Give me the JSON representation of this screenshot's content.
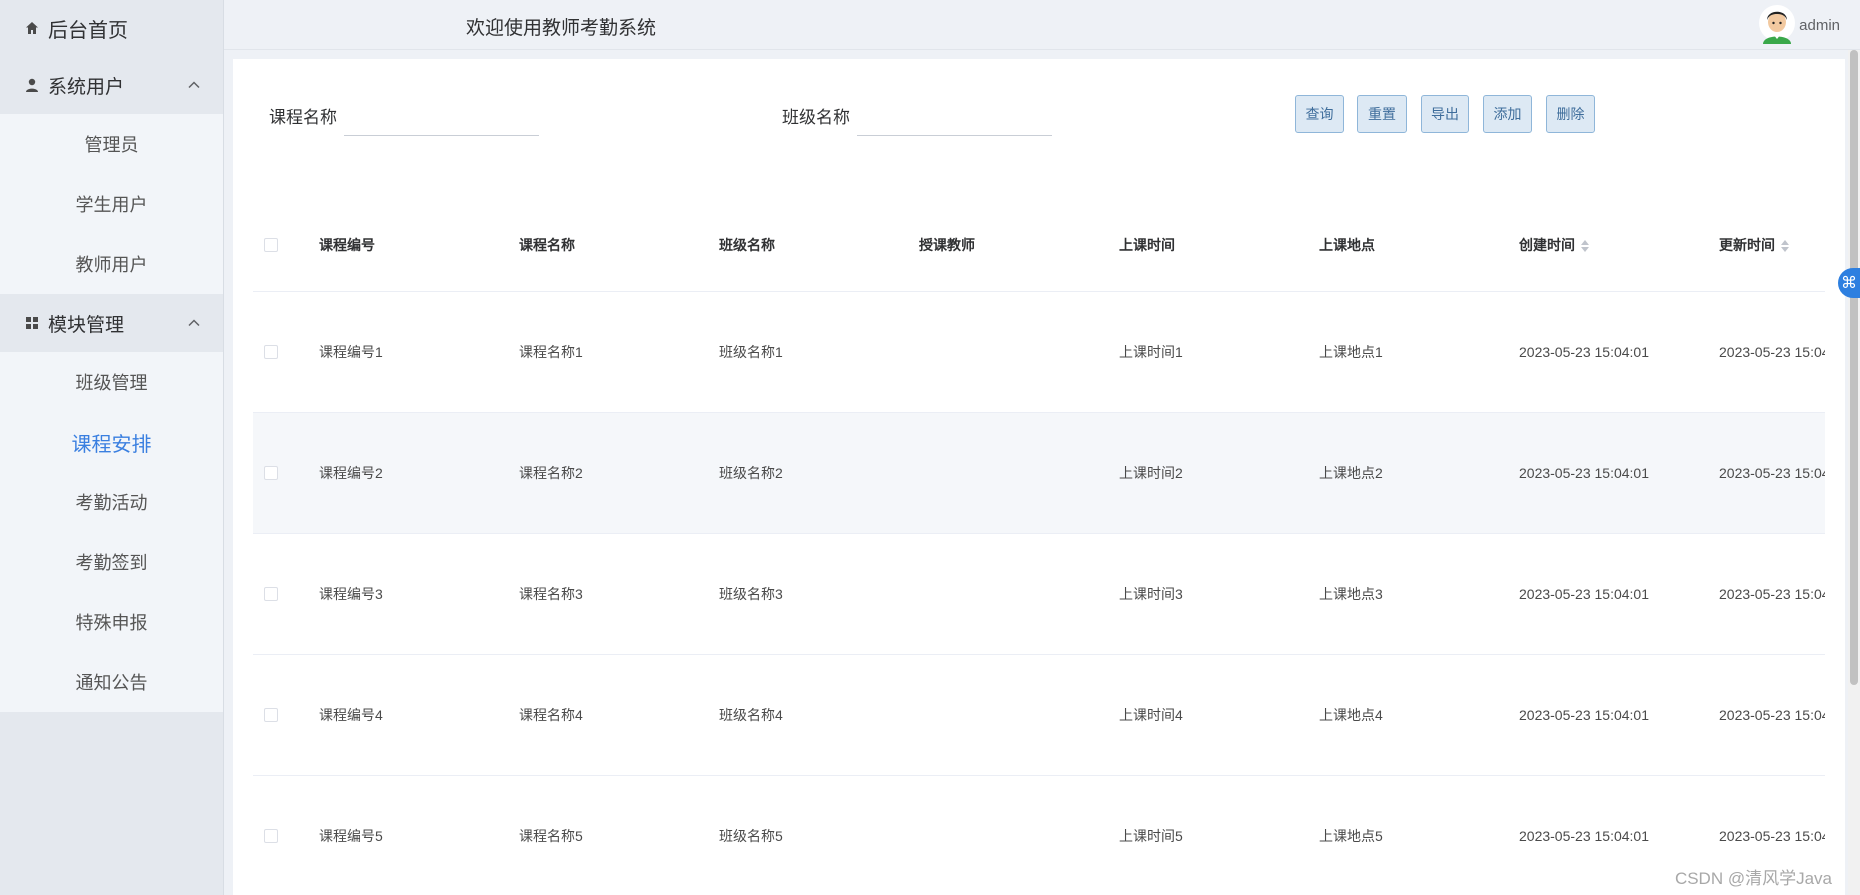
{
  "sidebar": {
    "home_label": "后台首页",
    "groups": [
      {
        "label": "系统用户",
        "items": [
          "管理员",
          "学生用户",
          "教师用户"
        ]
      },
      {
        "label": "模块管理",
        "items": [
          "班级管理",
          "课程安排",
          "考勤活动",
          "考勤签到",
          "特殊申报",
          "通知公告"
        ]
      }
    ],
    "active_item": "课程安排"
  },
  "header": {
    "title": "欢迎使用教师考勤系统",
    "username": "admin"
  },
  "search": {
    "course_name_label": "课程名称",
    "course_name_value": "",
    "class_name_label": "班级名称",
    "class_name_value": ""
  },
  "buttons": {
    "query": "查询",
    "reset": "重置",
    "export": "导出",
    "add": "添加",
    "delete": "删除"
  },
  "table": {
    "columns": [
      "课程编号",
      "课程名称",
      "班级名称",
      "授课教师",
      "上课时间",
      "上课地点",
      "创建时间",
      "更新时间"
    ],
    "rows": [
      [
        "课程编号1",
        "课程名称1",
        "班级名称1",
        "",
        "上课时间1",
        "上课地点1",
        "2023-05-23 15:04:01",
        "2023-05-23 15:04"
      ],
      [
        "课程编号2",
        "课程名称2",
        "班级名称2",
        "",
        "上课时间2",
        "上课地点2",
        "2023-05-23 15:04:01",
        "2023-05-23 15:04"
      ],
      [
        "课程编号3",
        "课程名称3",
        "班级名称3",
        "",
        "上课时间3",
        "上课地点3",
        "2023-05-23 15:04:01",
        "2023-05-23 15:04"
      ],
      [
        "课程编号4",
        "课程名称4",
        "班级名称4",
        "",
        "上课时间4",
        "上课地点4",
        "2023-05-23 15:04:01",
        "2023-05-23 15:04"
      ],
      [
        "课程编号5",
        "课程名称5",
        "班级名称5",
        "",
        "上课时间5",
        "上课地点5",
        "2023-05-23 15:04:01",
        "2023-05-23 15:04"
      ]
    ]
  },
  "watermark": "CSDN @清风学Java",
  "icons": {
    "home": "home-icon",
    "user": "user-icon",
    "grid": "grid-icon",
    "chevron": "chevron-up-icon",
    "avatar": "avatar-icon"
  },
  "colors": {
    "active": "#3a7fe0",
    "button_bg": "#dde9f4",
    "button_border": "#8fb6d9"
  }
}
